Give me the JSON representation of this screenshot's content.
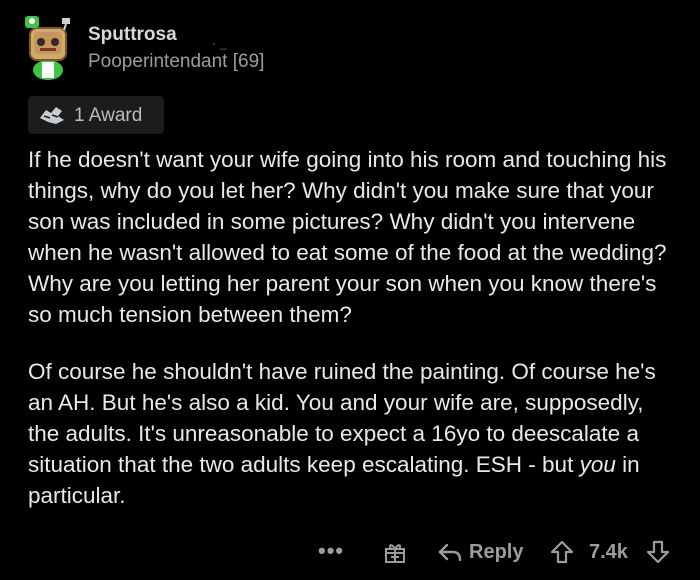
{
  "comment": {
    "username": "Sputtrosa",
    "flair": "Pooperintendant [69]",
    "award_label": "1 Award",
    "paragraphs": [
      "If he doesn't want your wife going into his room and touching his things, why do you let her? Why didn't you make sure that your son was included in some pictures? Why didn't you intervene when he wasn't allowed to eat some of the food at the wedding? Why are you letting her parent your son when you know there's so much tension between them?",
      "Of course he shouldn't have ruined the painting. Of course he's an AH. But he's also a kid. You and your wife are, supposedly, the adults. It's unreasonable to expect a 16yo to deescalate a situation that the two adults keep escalating. ESH - but "
    ],
    "emphasis": "you",
    "tail": " in particular."
  },
  "actions": {
    "more": "•••",
    "reply_label": "Reply",
    "score": "7.4k"
  },
  "colors": {
    "background": "#000000",
    "text": "#e7e9ea",
    "muted": "#9a9da0",
    "avatar_green": "#3ec44a"
  },
  "icons": {
    "avatar": "snoo-avatar",
    "award": "award-hands-icon",
    "more": "more-dots-icon",
    "gift": "gift-icon",
    "reply": "reply-arrow-icon",
    "upvote": "upvote-arrow-icon",
    "downvote": "downvote-arrow-icon"
  }
}
